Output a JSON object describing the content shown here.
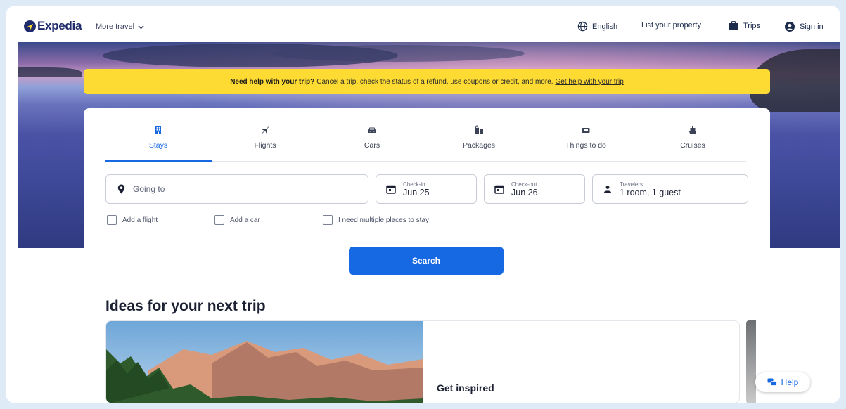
{
  "header": {
    "logo_text": "Expedia",
    "more_travel": "More travel",
    "language": "English",
    "list_property": "List your property",
    "trips": "Trips",
    "sign_in": "Sign in"
  },
  "banner": {
    "bold": "Need help with your trip?",
    "text": "Cancel a trip, check the status of a refund, use coupons or credit, and more.",
    "link": "Get help with your trip"
  },
  "tabs": [
    {
      "label": "Stays",
      "icon": "building-icon",
      "active": true
    },
    {
      "label": "Flights",
      "icon": "plane-icon",
      "active": false
    },
    {
      "label": "Cars",
      "icon": "car-icon",
      "active": false
    },
    {
      "label": "Packages",
      "icon": "packages-icon",
      "active": false
    },
    {
      "label": "Things to do",
      "icon": "ticket-icon",
      "active": false
    },
    {
      "label": "Cruises",
      "icon": "ship-icon",
      "active": false
    }
  ],
  "search": {
    "going_to_placeholder": "Going to",
    "checkin_label": "Check-in",
    "checkin_value": "Jun 25",
    "checkout_label": "Check-out",
    "checkout_value": "Jun 26",
    "travelers_label": "Travelers",
    "travelers_value": "1 room, 1 guest",
    "options": [
      "Add a flight",
      "Add a car",
      "I need multiple places to stay"
    ],
    "button": "Search"
  },
  "ideas": {
    "title": "Ideas for your next trip",
    "card_text": "Get inspired"
  },
  "help": {
    "label": "Help"
  },
  "colors": {
    "accent": "#1668e3",
    "banner": "#fddb32",
    "brand_navy": "#1f2b6c"
  }
}
